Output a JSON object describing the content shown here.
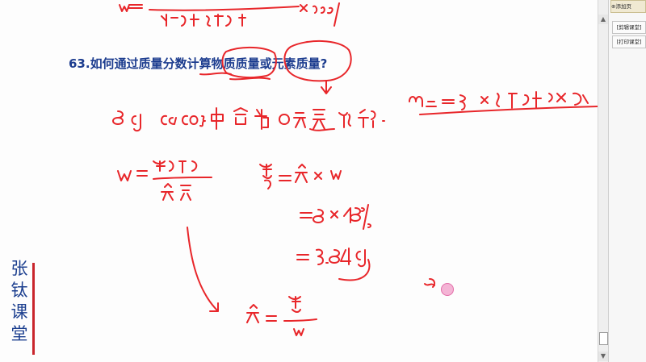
{
  "question": {
    "title": "63.如何通过质量分数计算物质质量或元素质量?"
  },
  "watermark": {
    "chars": [
      "张",
      "钛",
      "课",
      "堂"
    ]
  },
  "side_panel": {
    "top_label": "⊕添加页",
    "buttons": [
      "[剪辑课堂]",
      "[打印课堂]"
    ]
  },
  "colors": {
    "ink": "#e8262a",
    "title": "#1d3d8f",
    "watermark_text": "#1c3f8f",
    "watermark_bar": "#c9252c"
  }
}
